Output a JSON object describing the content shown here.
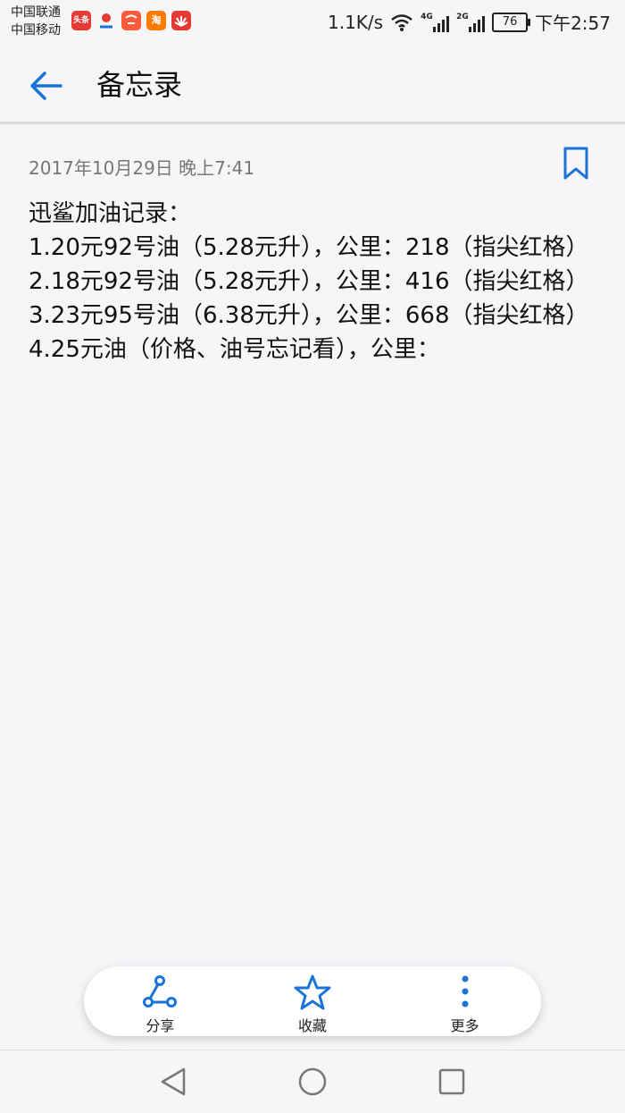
{
  "status_bar": {
    "carrier_1": "中国联通",
    "carrier_2": "中国移动",
    "net_speed": "1.1K/s",
    "sig1_label": "4G",
    "sig2_label": "2G",
    "battery": "76",
    "time": "下午2:57",
    "notif_icons": [
      {
        "name": "toutiao-app-icon",
        "text": "头条",
        "color": "#e53935"
      },
      {
        "name": "map-app-icon",
        "text": "",
        "color": "#ffffff"
      },
      {
        "name": "tmall-app-icon",
        "text": "",
        "color": "#ff5a3c"
      },
      {
        "name": "taobao-app-icon",
        "text": "淘",
        "color": "#ff7a00"
      },
      {
        "name": "huawei-app-icon",
        "text": "",
        "color": "#e53935"
      }
    ]
  },
  "app_bar": {
    "title": "备忘录"
  },
  "note": {
    "timestamp": "2017年10月29日 晚上7:41",
    "body": "迅鲨加油记录：\n1.20元92号油（5.28元升），公里：218（指尖红格）\n2.18元92号油（5.28元升），公里：416（指尖红格）\n3.23元95号油（6.38元升），公里：668（指尖红格）\n4.25元油（价格、油号忘记看），公里："
  },
  "toolbar": {
    "share_label": "分享",
    "favorite_label": "收藏",
    "more_label": "更多"
  },
  "colors": {
    "accent": "#1a73d9",
    "text": "#111111",
    "meta": "#777777",
    "background": "#f6f6f9"
  }
}
